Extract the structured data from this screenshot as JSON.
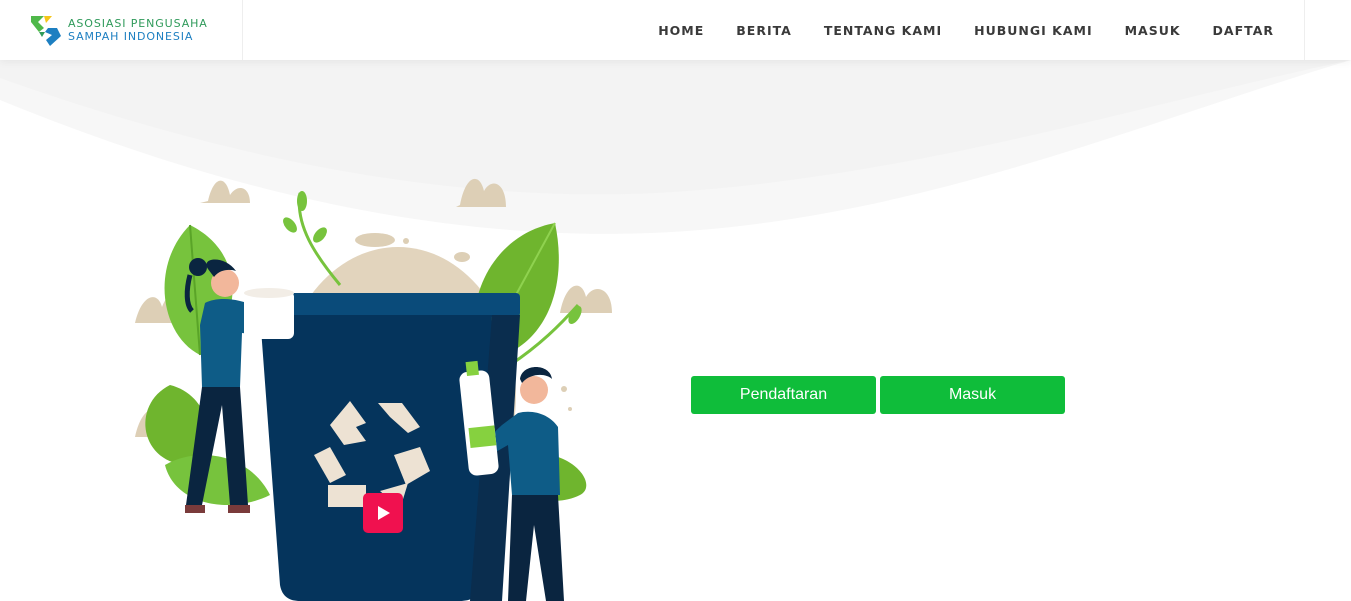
{
  "brand": {
    "line1": "ASOSIASI PENGUSAHA",
    "line2": "SAMPAH INDONESIA",
    "logo_icon": "asosiasi-logo-icon",
    "colors": {
      "green": "#2f9a5a",
      "blue": "#1d7fc1",
      "yellow": "#f5c518"
    }
  },
  "nav": {
    "items": [
      {
        "label": "HOME"
      },
      {
        "label": "BERITA"
      },
      {
        "label": "TENTANG KAMI"
      },
      {
        "label": "HUBUNGI KAMI"
      },
      {
        "label": "MASUK"
      },
      {
        "label": "DAFTAR"
      }
    ]
  },
  "hero": {
    "illustration": "recycling-bin-illustration",
    "play_icon": "play-icon",
    "buttons": {
      "register_label": "Pendaftaran",
      "login_label": "Masuk"
    },
    "colors": {
      "button": "#0fbd3a",
      "play": "#f0114f",
      "bin": "#05345c"
    }
  }
}
